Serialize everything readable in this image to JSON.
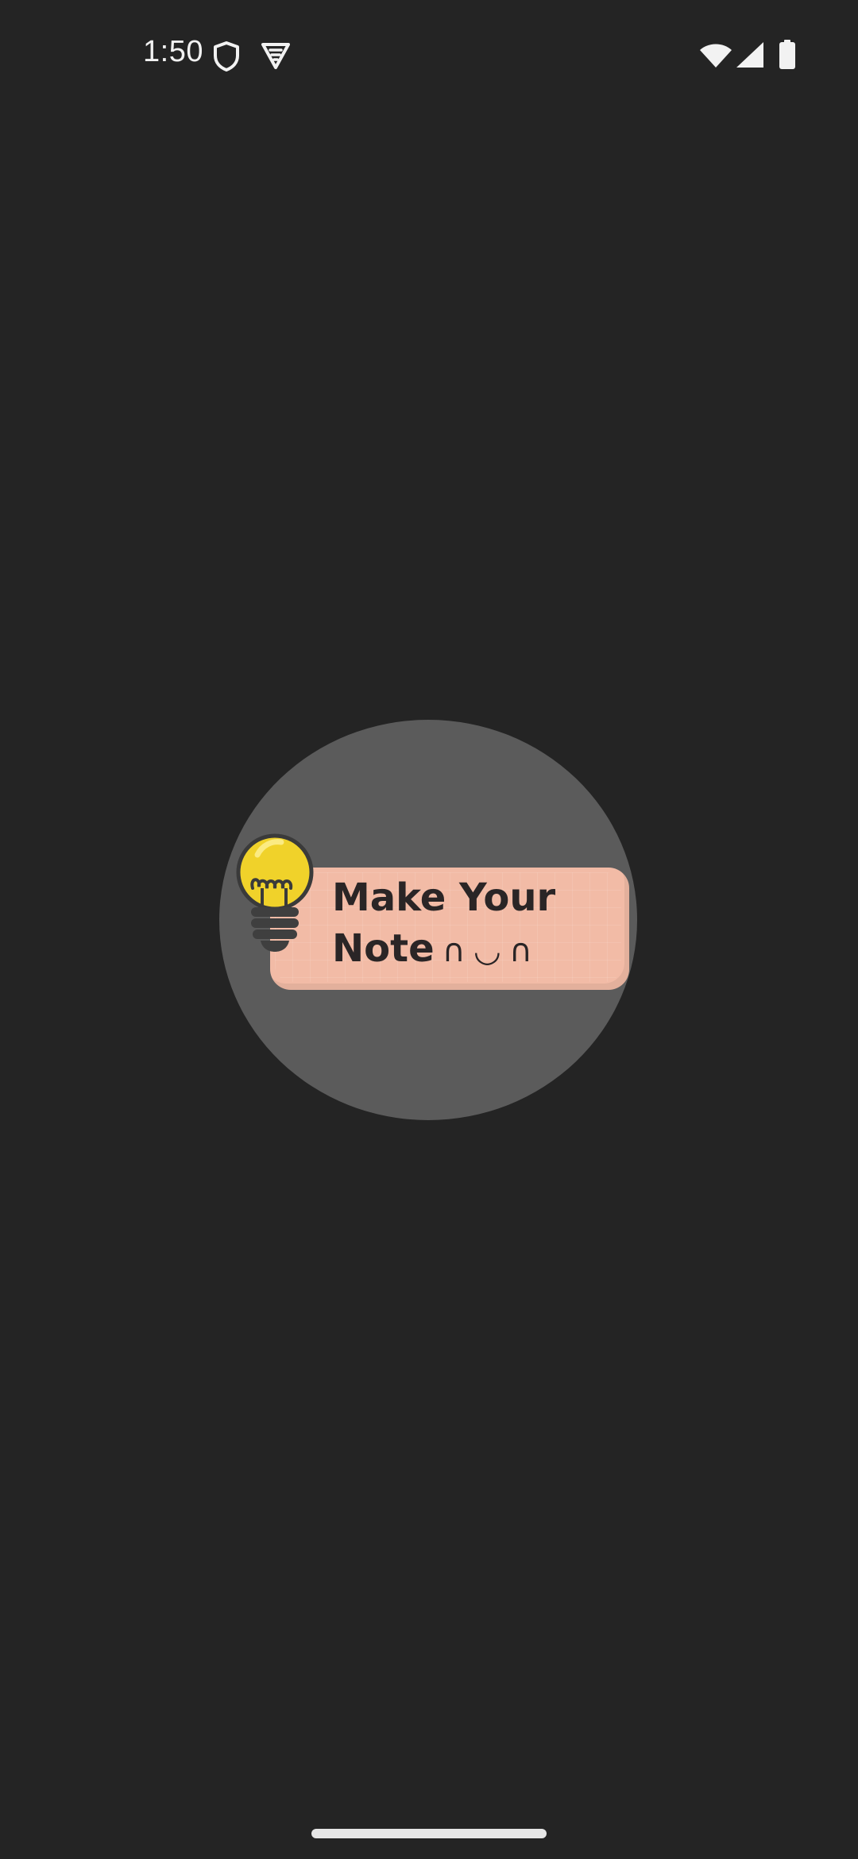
{
  "status_bar": {
    "time": "1:50",
    "icons": [
      "shield-icon",
      "vpn-icon",
      "wifi-icon",
      "signal-icon",
      "battery-icon"
    ]
  },
  "splash": {
    "logo_line_1": "Make Your",
    "logo_line_2": "Note",
    "logo_face": "∩◡∩",
    "colors": {
      "background": "#242424",
      "circle": "#5b5b5b",
      "banner": "#f2bba6",
      "bulb": "#f0d22a",
      "text": "#2a2526"
    }
  }
}
